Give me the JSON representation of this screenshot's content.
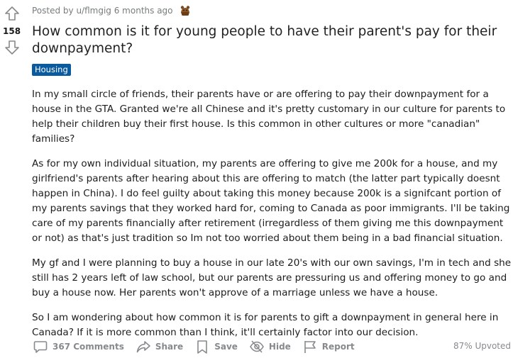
{
  "post": {
    "score": "158",
    "meta_text": "Posted by u/flmgig 6 months ago",
    "title": "How common is it for young people to have their parent's pay for their downpayment?",
    "flair": "Housing",
    "paragraphs": [
      "In my small circle of friends, their parents have or are offering to pay their downpayment for a house in the GTA. Granted we're all Chinese and it's pretty customary in our culture for parents to help their children buy their first house. Is this common in other cultures or more \"canadian\" families?",
      "As for my own individual situation, my parents are offering to give me 200k for a house, and my girlfriend's parents after hearing about this are offering to match (the latter part typically doesnt happen in China). I do feel guilty about taking this money because 200k is a signifcant portion of my parents savings that they worked hard for, coming to Canada as poor immigrants. I'll be taking care of my parents financially after retirement (irregardless of them giving me this downpayment or not) as that's just tradition so Im not too worried about them being in a bad financial situation.",
      "My gf and I were planning to buy a house in our late 20's with our own savings, I'm in tech and she still has 2 years left of law school, but our parents are pressuring us and offering money to go and buy a house now. Her parents won't approve of a marriage unless we have a house.",
      "So I am wondering about how common it is for parents to gift a downpayment in general here in Canada? If it is more common than I think, it'll certainly factor into our decision."
    ]
  },
  "actions": {
    "comments": "367 Comments",
    "share": "Share",
    "save": "Save",
    "hide": "Hide",
    "report": "Report"
  },
  "upvoted": "87% Upvoted",
  "icons": {
    "upvote": "arrow-up-icon",
    "downvote": "arrow-down-icon",
    "award": "award-icon",
    "comments": "comment-bubble-icon",
    "share": "share-arrow-icon",
    "save": "bookmark-icon",
    "hide": "eye-slash-icon",
    "report": "flag-icon"
  },
  "colors": {
    "flair_bg": "#0a5aa0",
    "muted_text": "#878a8c"
  }
}
